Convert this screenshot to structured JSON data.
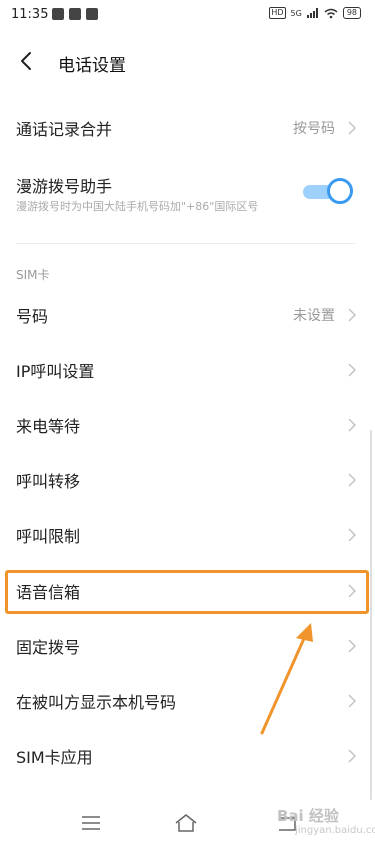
{
  "status_bar": {
    "time": "11:35",
    "hd": "HD",
    "network": "5G",
    "battery": "98"
  },
  "header": {
    "title": "电话设置"
  },
  "rows": {
    "merge": {
      "label": "通话记录合并",
      "value": "按号码"
    },
    "roaming": {
      "label": "漫游拨号助手",
      "subtitle": "漫游拨号时为中国大陆手机号码加\"+86\"国际区号",
      "toggle_on": true
    },
    "number": {
      "label": "号码",
      "value": "未设置"
    },
    "ip_call": {
      "label": "IP呼叫设置"
    },
    "call_waiting": {
      "label": "来电等待"
    },
    "call_forward": {
      "label": "呼叫转移"
    },
    "call_barring": {
      "label": "呼叫限制"
    },
    "voicemail": {
      "label": "语音信箱"
    },
    "fixed_dial": {
      "label": "固定拨号"
    },
    "show_number": {
      "label": "在被叫方显示本机号码"
    },
    "sim_apps": {
      "label": "SIM卡应用"
    }
  },
  "section": {
    "sim_title": "SIM卡"
  },
  "watermark": {
    "brand": "Bai 经验",
    "url": "jingyan.baidu.com"
  },
  "colors": {
    "accent": "#3a9af2",
    "highlight": "#f0942b"
  }
}
